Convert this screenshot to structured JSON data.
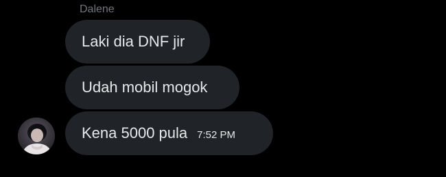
{
  "conversation": {
    "sender_name": "Dalene",
    "messages": [
      {
        "text": "Laki dia DNF jir"
      },
      {
        "text": "Udah mobil mogok"
      },
      {
        "text": "Kena 5000 pula",
        "timestamp": "7:52 PM"
      }
    ]
  },
  "colors": {
    "background": "#000000",
    "bubble": "#202327",
    "text": "#e7e9ea",
    "muted": "#71767b"
  }
}
